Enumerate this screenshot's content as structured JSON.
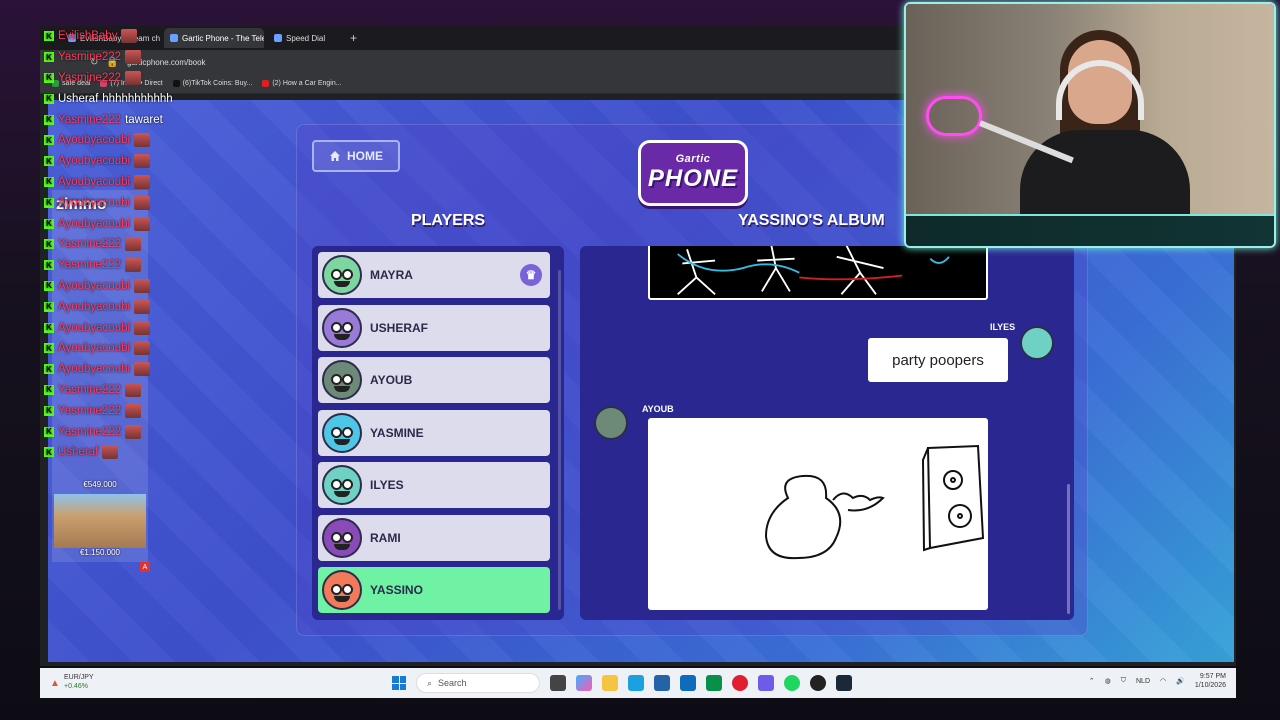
{
  "browser": {
    "tabs": [
      {
        "label": "EvilishBaby Stream chat"
      },
      {
        "label": "Gartic Phone - The Teleph"
      },
      {
        "label": "Speed Dial"
      }
    ],
    "new_tab": "+",
    "url": "garticphone.com/book",
    "bookmarks": [
      {
        "label": "safe deal",
        "color": "#2b9a3e"
      },
      {
        "label": "(7) Inbox • Direct",
        "color": "#d3436b"
      },
      {
        "label": "(6)TikTok Coins: Buy...",
        "color": "#111111"
      },
      {
        "label": "(2) How a Car Engin...",
        "color": "#e02020"
      }
    ]
  },
  "game": {
    "home_label": "HOME",
    "logo": {
      "line1": "Gartic",
      "line2": "PHONE"
    },
    "players_title": "PLAYERS",
    "album_title": "YASSINO'S ALBUM",
    "players": [
      {
        "name": "MAYRA",
        "color": "#7dd6a0",
        "host": true
      },
      {
        "name": "USHERAF",
        "color": "#9a7ad8"
      },
      {
        "name": "AYOUB",
        "color": "#6d8a78"
      },
      {
        "name": "YASMINE",
        "color": "#4ec6e6"
      },
      {
        "name": "ILYES",
        "color": "#6fd0c4"
      },
      {
        "name": "RAMI",
        "color": "#8a4ab8"
      },
      {
        "name": "YASSINO",
        "color": "#f07a5a",
        "active": true
      }
    ],
    "album": {
      "entry1_author": "ILYES",
      "entry1_text": "party poopers",
      "entry2_author": "AYOUB"
    }
  },
  "chat": {
    "lines": [
      {
        "user": "EvilishBaby",
        "msg": "",
        "emote": true
      },
      {
        "user": "Yasmine222",
        "msg": "",
        "emote": true
      },
      {
        "user": "Yasmine222",
        "msg": "",
        "emote": true
      },
      {
        "user": "Usheraf",
        "msg": "hhhhhhhhhhh",
        "white": true
      },
      {
        "user": "Yasmine222",
        "msg": "tawaret"
      },
      {
        "user": "Ayoubyacoubi",
        "msg": "",
        "emote": true
      },
      {
        "user": "Ayoubyacoubi",
        "msg": "",
        "emote": true
      },
      {
        "user": "Ayoubyacoubi",
        "msg": "",
        "emote": true
      },
      {
        "user": "Ayoubyacoubi",
        "msg": "",
        "emote": true
      },
      {
        "user": "Ayoubyacoubi",
        "msg": "",
        "emote": true
      },
      {
        "user": "Yasmine222",
        "msg": "",
        "emote": true
      },
      {
        "user": "Yasmine222",
        "msg": "",
        "emote": true
      },
      {
        "user": "Ayoubyacoubi",
        "msg": "",
        "emote": true
      },
      {
        "user": "Ayoubyacoubi",
        "msg": "",
        "emote": true
      },
      {
        "user": "Ayoubyacoubi",
        "msg": "",
        "emote": true
      },
      {
        "user": "Ayoubyacoubi",
        "msg": "",
        "emote": true
      },
      {
        "user": "Ayoubyacoubi",
        "msg": "",
        "emote": true
      },
      {
        "user": "Yasmine222",
        "msg": "",
        "emote": true
      },
      {
        "user": "Yasmine222",
        "msg": "",
        "emote": true
      },
      {
        "user": "Yasmine222",
        "msg": "",
        "emote": true
      },
      {
        "user": "Usheraf",
        "msg": "",
        "emote": true
      }
    ],
    "ad_brand": "zimmo",
    "ad_prices": [
      "€549.000",
      "€1.150.000"
    ],
    "ad_badge": "A"
  },
  "taskbar": {
    "ticker_name": "EUR/JPY",
    "ticker_change": "+0.46%",
    "search_placeholder": "Search",
    "lang": "NLD",
    "time": "9:57 PM",
    "date": "1/10/2026"
  }
}
